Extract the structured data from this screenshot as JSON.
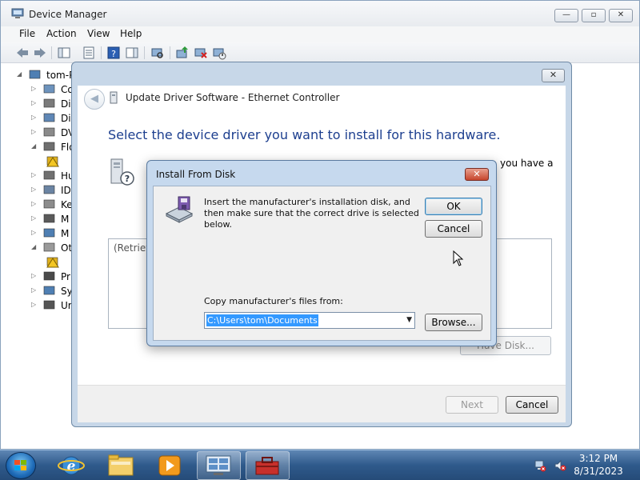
{
  "device_manager": {
    "title": "Device Manager",
    "menu": [
      "File",
      "Action",
      "View",
      "Help"
    ],
    "tree": [
      {
        "label": "tom-P",
        "expander": "◢",
        "icon": "computer-icon"
      },
      {
        "label": "Co",
        "expander": "▷",
        "icon": "computer-icon"
      },
      {
        "label": "Di",
        "expander": "▷",
        "icon": "disk-drive-icon"
      },
      {
        "label": "Di",
        "expander": "▷",
        "icon": "display-adapter-icon"
      },
      {
        "label": "DV",
        "expander": "▷",
        "icon": "dvd-drive-icon"
      },
      {
        "label": "Flo",
        "expander": "◢",
        "icon": "floppy-controller-icon"
      },
      {
        "label": "",
        "expander": "",
        "icon": "floppy-warning-icon"
      },
      {
        "label": "Hu",
        "expander": "▷",
        "icon": "hid-icon"
      },
      {
        "label": "ID",
        "expander": "▷",
        "icon": "ide-controller-icon"
      },
      {
        "label": "Ke",
        "expander": "▷",
        "icon": "keyboard-icon"
      },
      {
        "label": "M",
        "expander": "▷",
        "icon": "mouse-icon"
      },
      {
        "label": "M",
        "expander": "▷",
        "icon": "monitor-icon"
      },
      {
        "label": "Ot",
        "expander": "◢",
        "icon": "other-devices-icon"
      },
      {
        "label": "",
        "expander": "",
        "icon": "unknown-device-warning-icon"
      },
      {
        "label": "Pr",
        "expander": "▷",
        "icon": "processor-icon"
      },
      {
        "label": "Sy",
        "expander": "▷",
        "icon": "system-devices-icon"
      },
      {
        "label": "Ur",
        "expander": "▷",
        "icon": "usb-controller-icon"
      }
    ]
  },
  "wizard": {
    "title": "Update Driver Software - Ethernet Controller",
    "heading": "Select the device driver you want to install for this hardware.",
    "snippet": "you have a",
    "list_text": "(Retrievi",
    "have_disk_label": "Have Disk...",
    "next_label": "Next",
    "cancel_label": "Cancel"
  },
  "install_from_disk": {
    "title": "Install From Disk",
    "close_glyph": "✕",
    "message": "Insert the manufacturer's installation disk, and then make sure that the correct drive is selected below.",
    "ok_label": "OK",
    "cancel_label": "Cancel",
    "copy_label": "Copy manufacturer's files from:",
    "path_value": "C:\\Users\\tom\\Documents",
    "browse_label": "Browse..."
  },
  "taskbar": {
    "time": "3:12 PM",
    "date": "8/31/2023",
    "pinned": [
      "internet-explorer-icon",
      "file-explorer-icon",
      "media-player-icon",
      "device-manager-icon",
      "toolbox-icon"
    ]
  },
  "colors": {
    "heading": "#1d3f8f",
    "selection": "#3399ff",
    "taskbar": "#2f5a8b"
  }
}
